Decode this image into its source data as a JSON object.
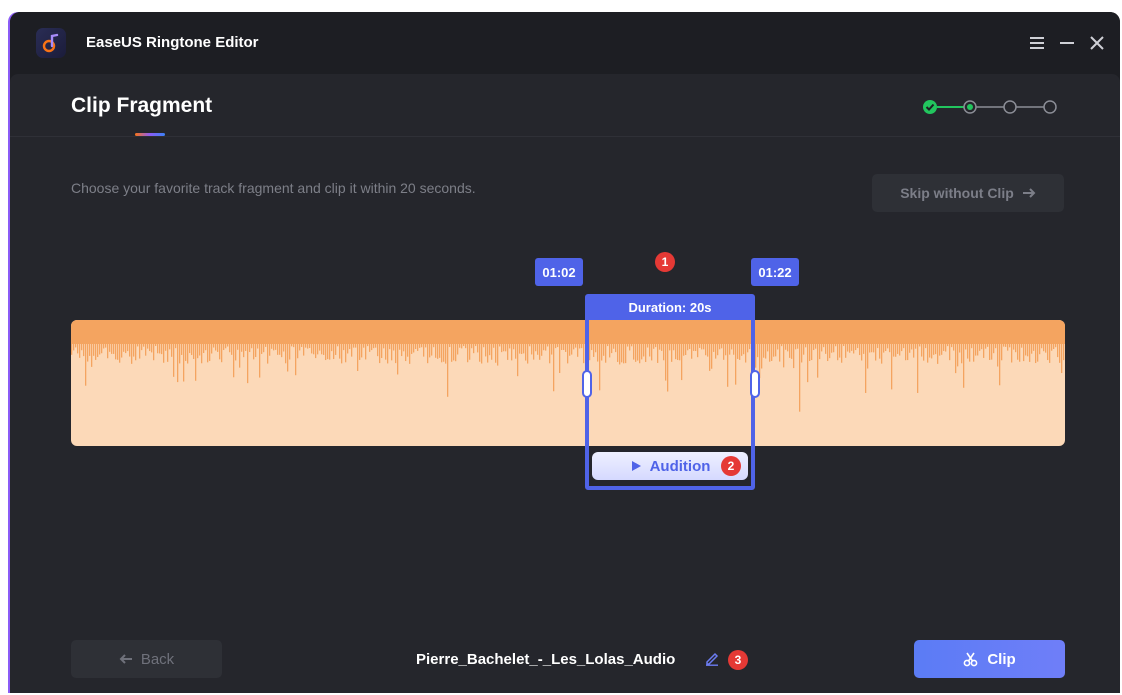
{
  "app": {
    "title": "EaseUS Ringtone Editor",
    "logo_icon": "music-note-logo-icon",
    "window_controls": [
      "menu-icon",
      "minimize-icon",
      "close-icon"
    ]
  },
  "page": {
    "title": "Clip Fragment",
    "steps": [
      {
        "state": "done"
      },
      {
        "state": "current"
      },
      {
        "state": "pending"
      },
      {
        "state": "pending"
      }
    ],
    "hint": "Choose your favorite track fragment and clip it within 20 seconds.",
    "skip_label": "Skip without Clip"
  },
  "editor": {
    "start_time": "01:02",
    "end_time": "01:22",
    "duration_label": "Duration: 20s",
    "audition_label": "Audition",
    "callouts": [
      "1",
      "2",
      "3"
    ],
    "colors": {
      "wave_bg": "#fcd9b8",
      "wave_fg": "#f4a460",
      "accent": "#4f63e8",
      "callout": "#e53935"
    }
  },
  "footer": {
    "back_label": "Back",
    "filename": "Pierre_Bachelet_-_Les_Lolas_Audio",
    "clip_label": "Clip"
  }
}
